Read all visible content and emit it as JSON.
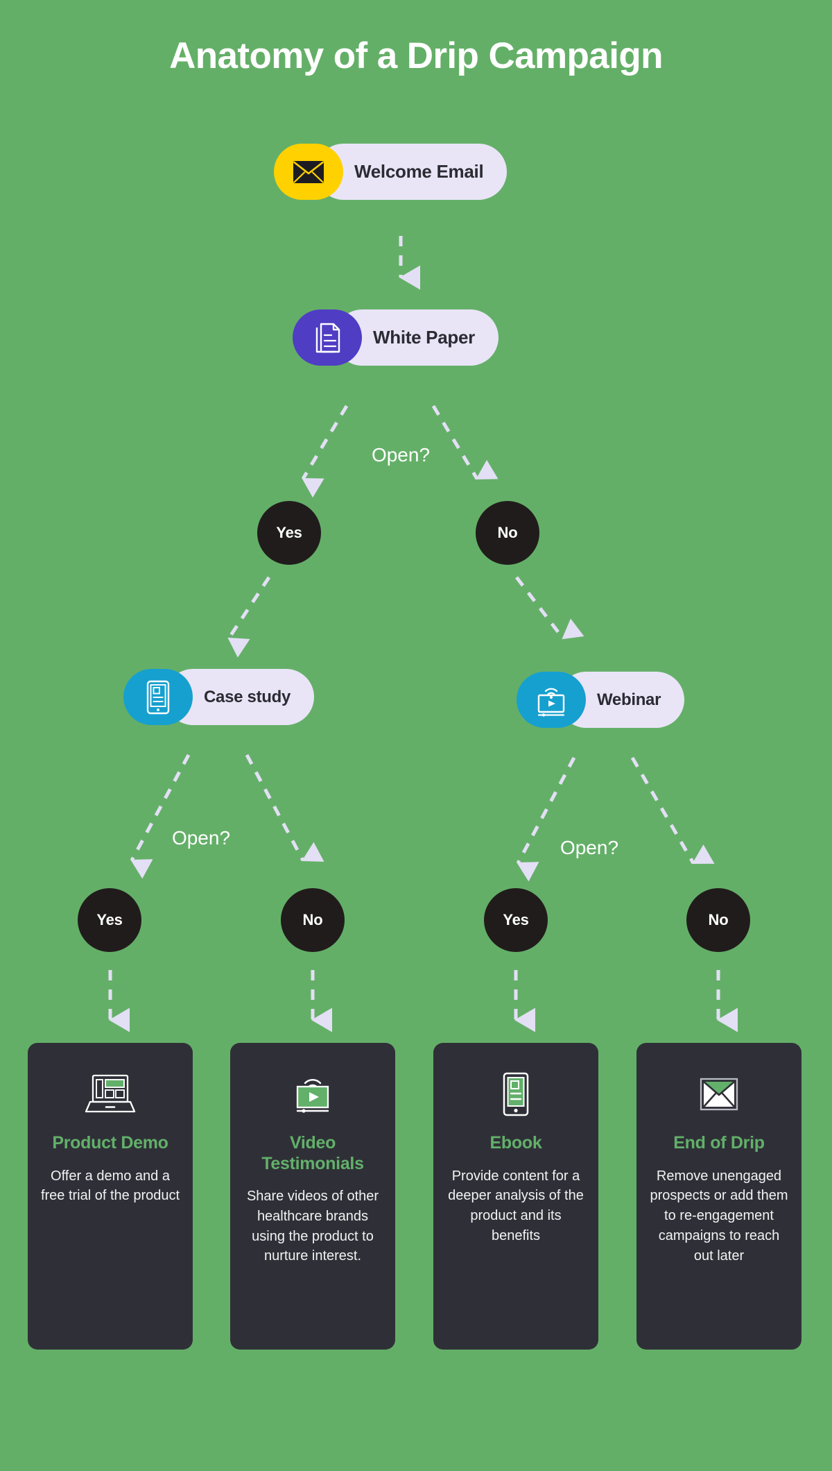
{
  "title": "Anatomy of a Drip Campaign",
  "colors": {
    "background": "#64af68",
    "pill_body": "#e9e5f7",
    "pill_text": "#2b2b33",
    "welcome_accent": "#ffd100",
    "whitepaper_accent": "#4f3dc4",
    "casestudy_accent": "#16a0cf",
    "webinar_accent": "#16a0cf",
    "circle_fill": "#211c1c",
    "circle_text": "#ffffff",
    "connector": "#e3dff5",
    "card_bg": "#2f3037",
    "card_title": "#62b06a",
    "card_text": "#f2f2f4",
    "icon_green": "#62b06a"
  },
  "flow": {
    "nodes": [
      {
        "id": "welcome",
        "label": "Welcome Email",
        "icon": "envelope-icon",
        "accent": "#ffd100",
        "icon_color": "#1c1c22"
      },
      {
        "id": "whitepaper",
        "label": "White Paper",
        "icon": "document-stack-icon",
        "accent": "#4f3dc4",
        "icon_color": "#ffffff"
      },
      {
        "id": "casestudy",
        "label": "Case study",
        "icon": "tablet-reader-icon",
        "accent": "#16a0cf",
        "icon_color": "#ffffff"
      },
      {
        "id": "webinar",
        "label": "Webinar",
        "icon": "webinar-screen-icon",
        "accent": "#16a0cf",
        "icon_color": "#ffffff"
      }
    ],
    "questions": [
      {
        "id": "q1",
        "label": "Open?"
      },
      {
        "id": "q2",
        "label": "Open?"
      },
      {
        "id": "q3",
        "label": "Open?"
      }
    ],
    "decisions": [
      {
        "id": "d1-yes",
        "label": "Yes"
      },
      {
        "id": "d1-no",
        "label": "No"
      },
      {
        "id": "d2-yes",
        "label": "Yes"
      },
      {
        "id": "d2-no",
        "label": "No"
      },
      {
        "id": "d3-yes",
        "label": "Yes"
      },
      {
        "id": "d3-no",
        "label": "No"
      }
    ]
  },
  "outcomes": [
    {
      "id": "product-demo",
      "icon": "laptop-icon",
      "title": "Product Demo",
      "description": "Offer a demo and a free trial of the product"
    },
    {
      "id": "video-testimonials",
      "icon": "video-play-icon",
      "title": "Video Testimonials",
      "description": "Share videos of other healthcare brands using the product to nurture interest."
    },
    {
      "id": "ebook",
      "icon": "tablet-book-icon",
      "title": "Ebook",
      "description": "Provide content for a deeper analysis of the product and its benefits"
    },
    {
      "id": "end-of-drip",
      "icon": "envelope-open-icon",
      "title": "End of Drip",
      "description": "Remove unengaged prospects or add them to re-engagement campaigns to reach out later"
    }
  ]
}
